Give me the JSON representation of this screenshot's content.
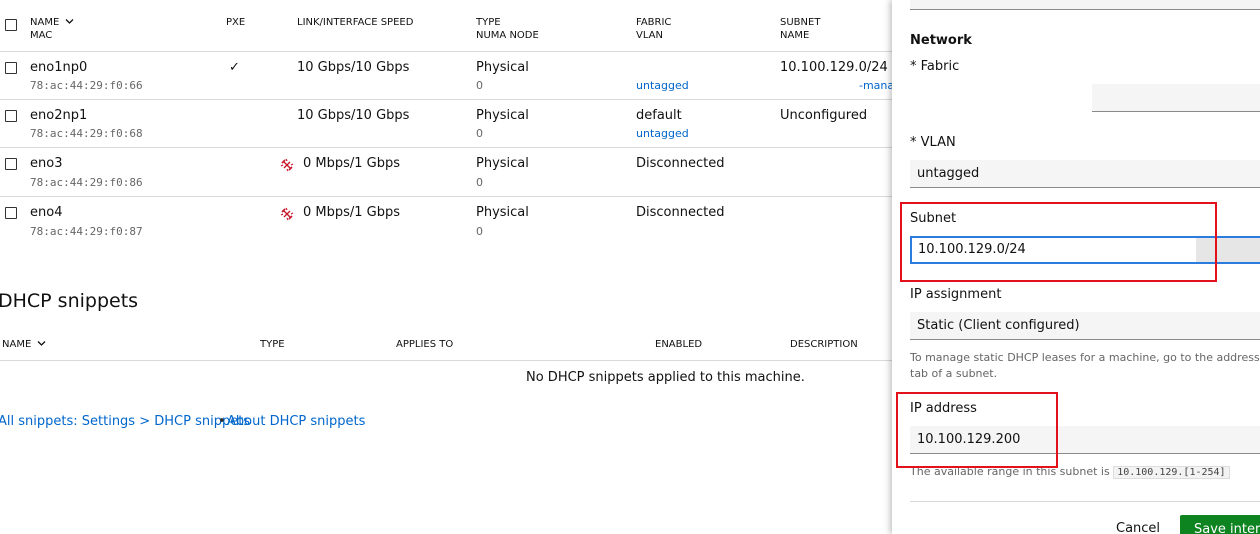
{
  "interfaces": {
    "headers": {
      "name": "NAME",
      "mac": "MAC",
      "pxe": "PXE",
      "speed": "LINK/INTERFACE SPEED",
      "type": "TYPE",
      "numa": "NUMA NODE",
      "fabric": "FABRIC",
      "vlan": "VLAN",
      "subnet": "SUBNET",
      "subnet_name": "NAME"
    },
    "rows": [
      {
        "name": "eno1np0",
        "mac": "78:ac:44:29:f0:66",
        "pxe": "✓",
        "speed": "10 Gbps/10 Gbps",
        "speed_warn": false,
        "type": "Physical",
        "numa": "0",
        "fabric": "",
        "vlan": "untagged",
        "subnet": "10.100.129.0/24",
        "subnet_sub": "-mana"
      },
      {
        "name": "eno2np1",
        "mac": "78:ac:44:29:f0:68",
        "pxe": "",
        "speed": "10 Gbps/10 Gbps",
        "speed_warn": false,
        "type": "Physical",
        "numa": "0",
        "fabric": "default",
        "vlan": "untagged",
        "subnet": "Unconfigured",
        "subnet_sub": ""
      },
      {
        "name": "eno3",
        "mac": "78:ac:44:29:f0:86",
        "pxe": "",
        "speed": "0 Mbps/1 Gbps",
        "speed_warn": true,
        "type": "Physical",
        "numa": "0",
        "fabric": "Disconnected",
        "vlan": "",
        "subnet": "",
        "subnet_sub": ""
      },
      {
        "name": "eno4",
        "mac": "78:ac:44:29:f0:87",
        "pxe": "",
        "speed": "0 Mbps/1 Gbps",
        "speed_warn": true,
        "type": "Physical",
        "numa": "0",
        "fabric": "Disconnected",
        "vlan": "",
        "subnet": "",
        "subnet_sub": ""
      }
    ]
  },
  "dhcp": {
    "title": "DHCP snippets",
    "headers": {
      "name": "NAME",
      "type": "TYPE",
      "applies_to": "APPLIES TO",
      "enabled": "ENABLED",
      "description": "DESCRIPTION"
    },
    "empty": "No DHCP snippets applied to this machine.",
    "link_all": "All snippets: Settings > DHCP snippets",
    "sep": "•",
    "link_about": "About DHCP snippets"
  },
  "panel": {
    "top_field_value": "",
    "network_heading": "Network",
    "fabric_label": "* Fabric",
    "fabric_value": "",
    "vlan_label": "* VLAN",
    "vlan_value": "untagged",
    "subnet_label": "Subnet",
    "subnet_value": "10.100.129.0/24",
    "ip_assign_label": "IP assignment",
    "ip_assign_value": "Static (Client configured)",
    "ip_assign_help_1": "To manage static DHCP leases for a machine, go to the address reserva",
    "ip_assign_help_2": "tab of a subnet.",
    "ip_label": "IP address",
    "ip_value": "10.100.129.200",
    "ip_help_prefix": "The available range in this subnet is",
    "ip_help_range": "10.100.129.[1-254]",
    "cancel": "Cancel",
    "save": "Save interfa"
  },
  "colors": {
    "accent": "#0066cc",
    "highlight": "#e3121a",
    "save_button": "#0e8420"
  }
}
